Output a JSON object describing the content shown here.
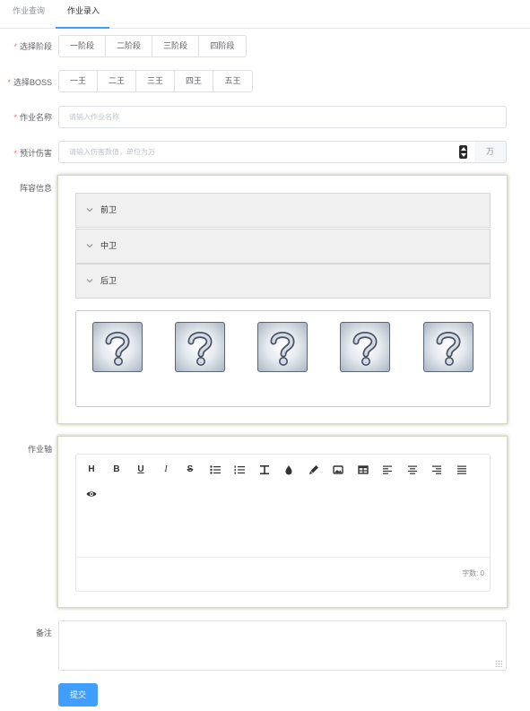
{
  "tabs": [
    {
      "label": "作业查询"
    },
    {
      "label": "作业录入"
    }
  ],
  "form": {
    "stage": {
      "label": "选择阶段",
      "options": [
        "一阶段",
        "二阶段",
        "三阶段",
        "四阶段"
      ]
    },
    "boss": {
      "label": "选择BOSS",
      "options": [
        "一王",
        "二王",
        "三王",
        "四王",
        "五王"
      ]
    },
    "name": {
      "label": "作业名称",
      "placeholder": "请输入作业名称"
    },
    "damage": {
      "label": "预计伤害",
      "placeholder": "请输入伤害数值，单位为万",
      "unit": "万"
    },
    "lineup": {
      "label": "阵容信息",
      "panels": [
        {
          "title": "前卫"
        },
        {
          "title": "中卫"
        },
        {
          "title": "后卫"
        }
      ],
      "slot_icon": "unknown-character-icon",
      "slot_count": 5
    },
    "axis": {
      "label": "作业轴",
      "toolbar": [
        "heading-icon",
        "bold-icon",
        "underline-icon",
        "italic-icon",
        "strikethrough-icon",
        "bullet-list-icon",
        "ordered-list-icon",
        "clear-format-icon",
        "text-color-icon",
        "highlight-icon",
        "image-icon",
        "table-icon",
        "align-left-icon",
        "align-center-icon",
        "align-right-icon",
        "justify-icon",
        "preview-icon"
      ],
      "word_count": "字数: 0"
    },
    "remark": {
      "label": "备注"
    },
    "submit": "提交"
  },
  "colors": {
    "primary": "#409eff",
    "required": "#f56c6c"
  }
}
